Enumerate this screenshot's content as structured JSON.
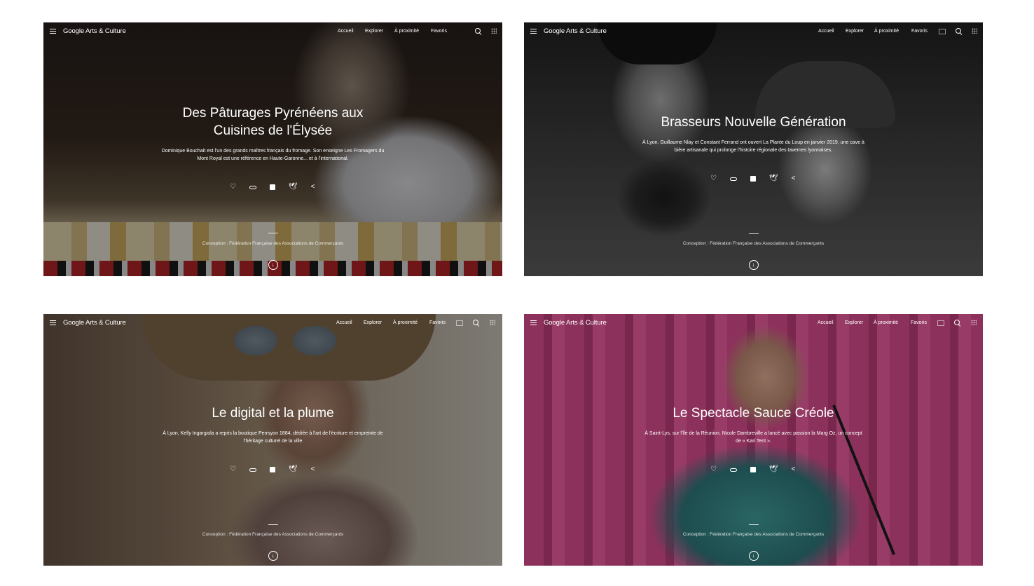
{
  "brand": "Google Arts & Culture",
  "nav": {
    "home": "Accueil",
    "explore": "Explorer",
    "nearby": "À proximité",
    "favorites": "Favoris"
  },
  "icons": {
    "menu": "menu-icon",
    "search": "search-icon",
    "apps": "apps-icon",
    "cast": "cast-icon",
    "like": "heart-icon",
    "link": "link-icon",
    "facebook": "facebook-icon",
    "twitter": "twitter-icon",
    "share": "share-icon",
    "scroll": "arrow-down-circle-icon"
  },
  "credit": "Conception : Fédération Française des Associations de Commerçants",
  "stories": [
    {
      "title": "Des Pâturages Pyrénéens aux Cuisines de l'Élysée",
      "description": "Dominique Bouchait est l'un des grands maîtres français du fromage. Son enseigne Les Fromagers du Mont Royal est une référence en Haute-Garonne... et à l'international."
    },
    {
      "title": "Brasseurs Nouvelle Génération",
      "description": "À Lyon, Guillaume Nlay et Constant Ferrand ont ouvert La Plante du Loup en janvier 2019, une cave à bière artisanale qui prolonge l'histoire régionale des tavernes lyonnaises."
    },
    {
      "title": "Le digital et la plume",
      "description": "À Lyon, Kelly Ingargiola a repris la boutique Perrsyon 1884, dédiée à l'art de l'écriture et empreinte de l'héritage culturel de la ville"
    },
    {
      "title": "Le Spectacle Sauce Créole",
      "description": "À Saint-Lys, sur l'île de la Réunion, Nicole Dambreville a lancé avec passion la Marg Oz, un concept de « Kari Tent »."
    }
  ]
}
